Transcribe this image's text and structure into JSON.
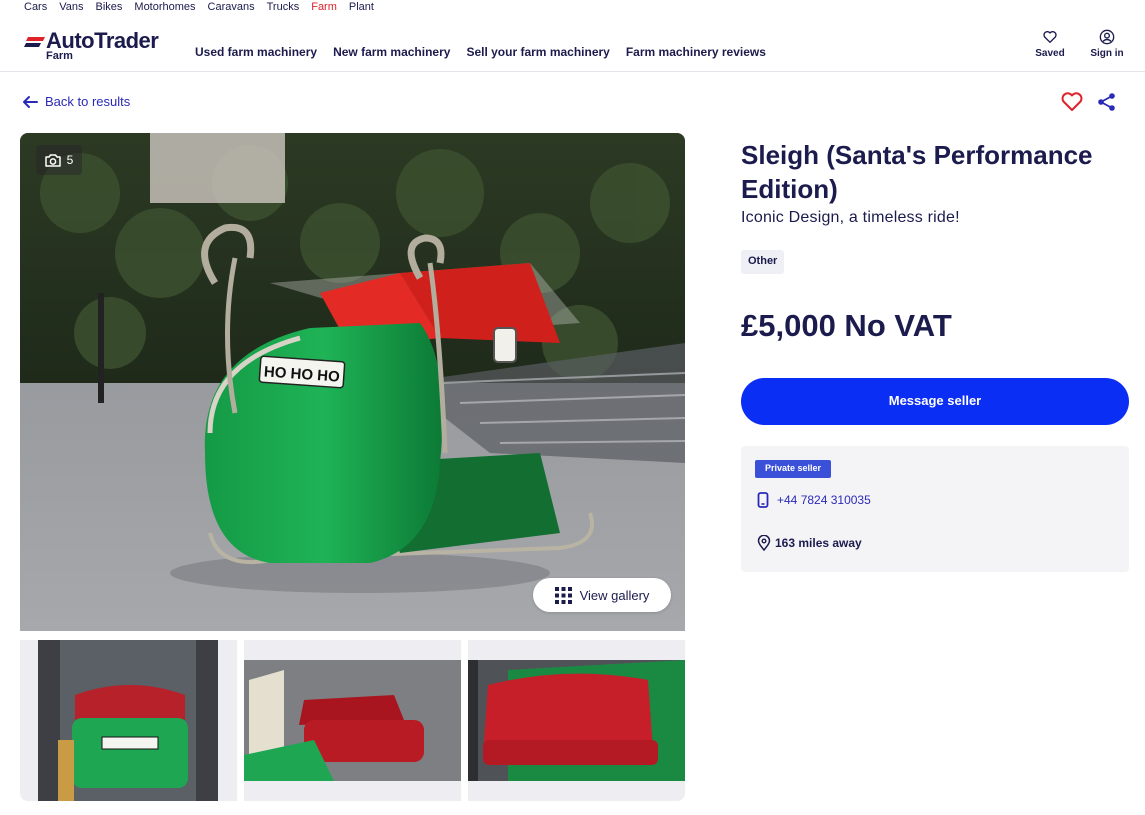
{
  "topnav": {
    "items": [
      "Cars",
      "Vans",
      "Bikes",
      "Motorhomes",
      "Caravans",
      "Trucks",
      "Farm",
      "Plant"
    ],
    "active": "Farm"
  },
  "header": {
    "logo_text": "AutoTrader",
    "logo_sub": "Farm",
    "nav": [
      "Used farm machinery",
      "New farm machinery",
      "Sell your farm machinery",
      "Farm machinery reviews"
    ],
    "saved_label": "Saved",
    "signin_label": "Sign in"
  },
  "back_label": "Back to results",
  "gallery": {
    "photo_count": "5",
    "view_gallery_label": "View gallery",
    "plate_text": "HO HO HO"
  },
  "listing": {
    "title": "Sleigh (Santa's Performance Edition)",
    "subtitle": "Iconic Design, a timeless ride!",
    "tag": "Other",
    "price": "£5,000 No VAT",
    "message_label": "Message seller"
  },
  "seller": {
    "badge": "Private seller",
    "phone": "+44 7824 310035",
    "distance": "163 miles away"
  },
  "colors": {
    "primary_button": "#0b2ef4",
    "brand_red": "#e0222a",
    "text_navy": "#1b1b4d",
    "link_blue": "#2a2ab8"
  },
  "icons": [
    "arrow-left-icon",
    "heart-icon",
    "share-icon",
    "camera-icon",
    "grid-icon",
    "phone-icon",
    "location-pin-icon",
    "user-circle-icon"
  ]
}
